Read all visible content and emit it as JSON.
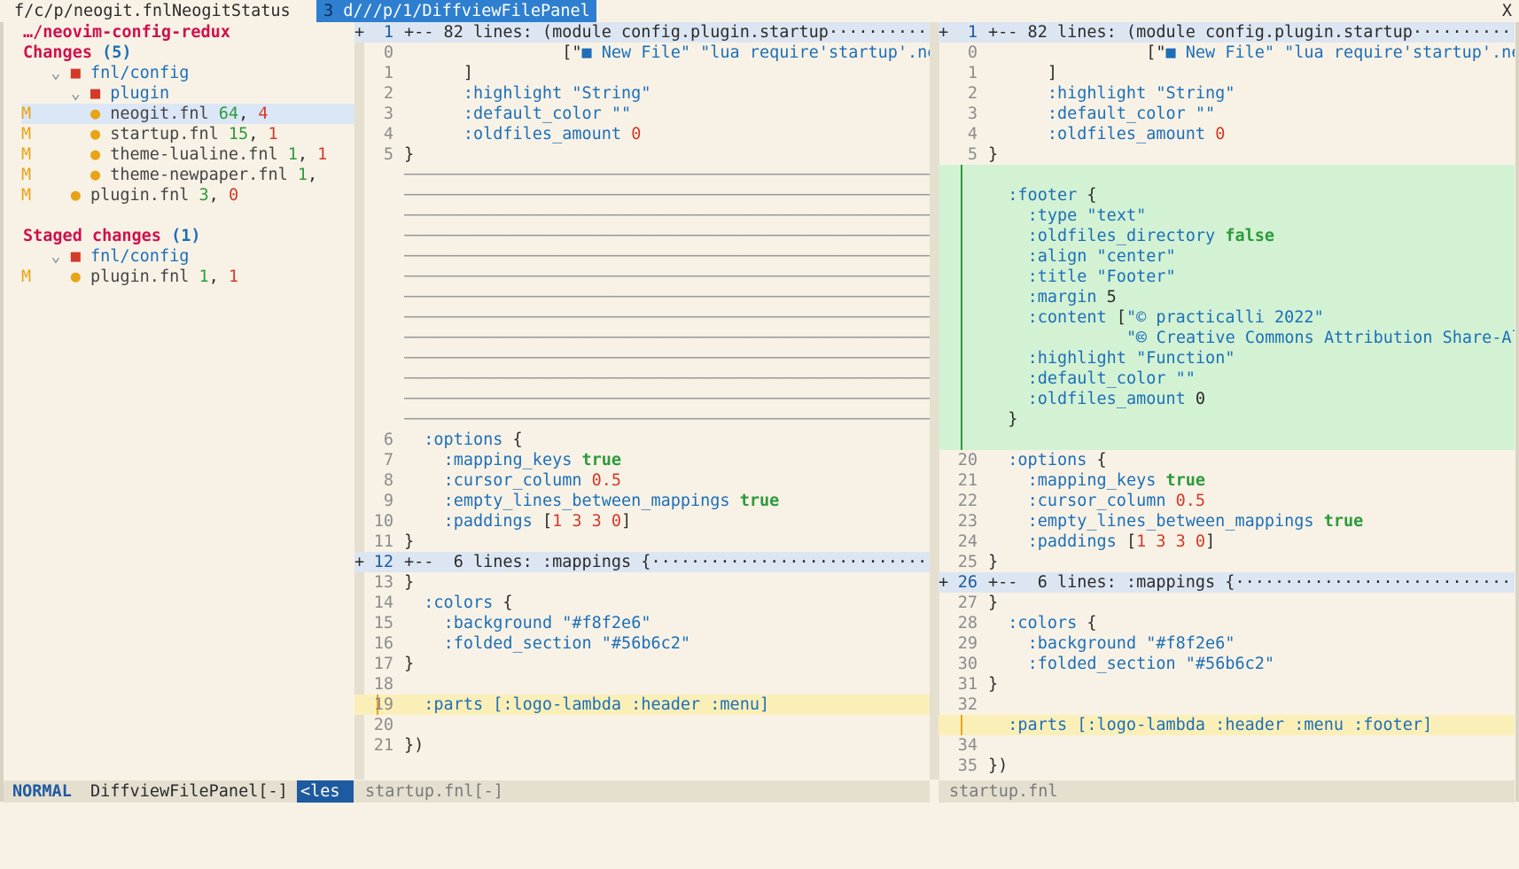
{
  "tabline": {
    "tab1": "f/c/p/neogit.fnl",
    "tab2": "NeogitStatus",
    "tab3_num": "3",
    "tab3_label": "d///p/1/DiffviewFilePanel",
    "close": "X"
  },
  "file_panel": {
    "root": "…/neovim-config-redux",
    "changes_header": "Changes",
    "changes_count": "(5)",
    "staged_header": "Staged changes",
    "staged_count": "(1)",
    "changes": [
      {
        "type": "dir",
        "depth": 1,
        "name": "fnl/config"
      },
      {
        "type": "dir",
        "depth": 2,
        "name": "plugin"
      },
      {
        "type": "file",
        "depth": 3,
        "status": "M",
        "name": "neogit.fnl",
        "add": "64",
        "del": "4",
        "selected": true
      },
      {
        "type": "file",
        "depth": 3,
        "status": "M",
        "name": "startup.fnl",
        "add": "15",
        "del": "1"
      },
      {
        "type": "file",
        "depth": 3,
        "status": "M",
        "name": "theme-lualine.fnl",
        "add": "1",
        "del": "1"
      },
      {
        "type": "file",
        "depth": 3,
        "status": "M",
        "name": "theme-newpaper.fnl",
        "add": "1",
        "del": ""
      },
      {
        "type": "file",
        "depth": 2,
        "status": "M",
        "name": "plugin.fnl",
        "add": "3",
        "del": "0"
      }
    ],
    "staged": [
      {
        "type": "dir",
        "depth": 1,
        "name": "fnl/config"
      },
      {
        "type": "file",
        "depth": 2,
        "status": "M",
        "name": "plugin.fnl",
        "add": "1",
        "del": "1"
      }
    ]
  },
  "left_pane": {
    "lines": [
      {
        "kind": "fold",
        "sign": "+",
        "ln": "1",
        "text": "+-- 82 lines: (module config.plugin.startup··········"
      },
      {
        "kind": "code",
        "ln": "0",
        "segs": [
          [
            "                [\"",
            ""
          ],
          [
            "■ ",
            "nf"
          ],
          [
            "New File\" \"lua require'startup'.new_fi",
            "str"
          ]
        ]
      },
      {
        "kind": "code",
        "ln": "1",
        "segs": [
          [
            "      ]",
            ""
          ]
        ]
      },
      {
        "kind": "code",
        "ln": "2",
        "segs": [
          [
            "      ",
            ""
          ],
          [
            ":highlight",
            "kw"
          ],
          [
            " ",
            ""
          ],
          [
            "\"String\"",
            "str"
          ]
        ]
      },
      {
        "kind": "code",
        "ln": "3",
        "segs": [
          [
            "      ",
            ""
          ],
          [
            ":default_color",
            "kw"
          ],
          [
            " ",
            ""
          ],
          [
            "\"\"",
            "str"
          ]
        ]
      },
      {
        "kind": "code",
        "ln": "4",
        "segs": [
          [
            "      ",
            ""
          ],
          [
            ":oldfiles_amount",
            "kw"
          ],
          [
            " ",
            ""
          ],
          [
            "0",
            "num"
          ]
        ]
      },
      {
        "kind": "code",
        "ln": "5",
        "segs": [
          [
            "}",
            ""
          ]
        ]
      },
      {
        "kind": "filler"
      },
      {
        "kind": "filler"
      },
      {
        "kind": "filler"
      },
      {
        "kind": "filler"
      },
      {
        "kind": "filler"
      },
      {
        "kind": "filler"
      },
      {
        "kind": "filler"
      },
      {
        "kind": "filler"
      },
      {
        "kind": "filler"
      },
      {
        "kind": "filler"
      },
      {
        "kind": "filler"
      },
      {
        "kind": "filler"
      },
      {
        "kind": "filler"
      },
      {
        "kind": "code",
        "ln": "6",
        "segs": [
          [
            "  ",
            ""
          ],
          [
            ":options",
            "kw"
          ],
          [
            " {",
            ""
          ]
        ]
      },
      {
        "kind": "code",
        "ln": "7",
        "segs": [
          [
            "    ",
            ""
          ],
          [
            ":mapping_keys",
            "kw"
          ],
          [
            " ",
            ""
          ],
          [
            "true",
            "bool"
          ]
        ]
      },
      {
        "kind": "code",
        "ln": "8",
        "segs": [
          [
            "    ",
            ""
          ],
          [
            ":cursor_column",
            "kw"
          ],
          [
            " ",
            ""
          ],
          [
            "0.5",
            "num"
          ]
        ]
      },
      {
        "kind": "code",
        "ln": "9",
        "segs": [
          [
            "    ",
            ""
          ],
          [
            ":empty_lines_between_mappings",
            "kw"
          ],
          [
            " ",
            ""
          ],
          [
            "true",
            "bool"
          ]
        ]
      },
      {
        "kind": "code",
        "ln": "10",
        "segs": [
          [
            "    ",
            ""
          ],
          [
            ":paddings",
            "kw"
          ],
          [
            " [",
            ""
          ],
          [
            "1 3 3 0",
            "num"
          ],
          [
            "]",
            ""
          ]
        ]
      },
      {
        "kind": "code",
        "ln": "11",
        "segs": [
          [
            "}",
            ""
          ]
        ]
      },
      {
        "kind": "fold",
        "sign": "+",
        "ln": "12",
        "text": "+--  6 lines: :mappings {·····························"
      },
      {
        "kind": "code",
        "ln": "13",
        "segs": [
          [
            "}",
            ""
          ]
        ]
      },
      {
        "kind": "code",
        "ln": "14",
        "segs": [
          [
            "  ",
            ""
          ],
          [
            ":colors",
            "kw"
          ],
          [
            " {",
            ""
          ]
        ]
      },
      {
        "kind": "code",
        "ln": "15",
        "segs": [
          [
            "    ",
            ""
          ],
          [
            ":background",
            "kw"
          ],
          [
            " ",
            ""
          ],
          [
            "\"#f8f2e6\"",
            "str"
          ]
        ]
      },
      {
        "kind": "code",
        "ln": "16",
        "segs": [
          [
            "    ",
            ""
          ],
          [
            ":folded_section",
            "kw"
          ],
          [
            " ",
            ""
          ],
          [
            "\"#56b6c2\"",
            "str"
          ]
        ]
      },
      {
        "kind": "code",
        "ln": "17",
        "segs": [
          [
            "}",
            ""
          ]
        ]
      },
      {
        "kind": "code",
        "ln": "18",
        "segs": [
          [
            "",
            ""
          ]
        ]
      },
      {
        "kind": "changed",
        "ln": "19",
        "segs": [
          [
            "  ",
            ""
          ],
          [
            ":parts [:logo-lambda :header :menu]",
            "kw"
          ]
        ]
      },
      {
        "kind": "code",
        "ln": "20",
        "segs": [
          [
            "",
            ""
          ]
        ]
      },
      {
        "kind": "code",
        "ln": "21",
        "segs": [
          [
            "})",
            ""
          ]
        ]
      }
    ],
    "status": "startup.fnl[-]"
  },
  "right_pane": {
    "lines": [
      {
        "kind": "fold",
        "sign": "+",
        "ln": "1",
        "text": "+-- 82 lines: (module config.plugin.startup··········"
      },
      {
        "kind": "code",
        "ln": "0",
        "segs": [
          [
            "                [\"",
            ""
          ],
          [
            "■ ",
            "nf"
          ],
          [
            "New File\" \"lua require'startup'.new_fi",
            "str"
          ]
        ]
      },
      {
        "kind": "code",
        "ln": "1",
        "segs": [
          [
            "      ]",
            ""
          ]
        ]
      },
      {
        "kind": "code",
        "ln": "2",
        "segs": [
          [
            "      ",
            ""
          ],
          [
            ":highlight",
            "kw"
          ],
          [
            " ",
            ""
          ],
          [
            "\"String\"",
            "str"
          ]
        ]
      },
      {
        "kind": "code",
        "ln": "3",
        "segs": [
          [
            "      ",
            ""
          ],
          [
            ":default_color",
            "kw"
          ],
          [
            " ",
            ""
          ],
          [
            "\"\"",
            "str"
          ]
        ]
      },
      {
        "kind": "code",
        "ln": "4",
        "segs": [
          [
            "      ",
            ""
          ],
          [
            ":oldfiles_amount",
            "kw"
          ],
          [
            " ",
            ""
          ],
          [
            "0",
            "num"
          ]
        ]
      },
      {
        "kind": "code",
        "ln": "5",
        "segs": [
          [
            "}",
            ""
          ]
        ]
      },
      {
        "kind": "added",
        "segs": [
          [
            "",
            ""
          ]
        ]
      },
      {
        "kind": "added",
        "segs": [
          [
            "  ",
            ""
          ],
          [
            ":footer",
            "kw"
          ],
          [
            " {",
            ""
          ]
        ]
      },
      {
        "kind": "added",
        "segs": [
          [
            "    ",
            ""
          ],
          [
            ":type",
            "kw"
          ],
          [
            " ",
            ""
          ],
          [
            "\"text\"",
            "str"
          ]
        ]
      },
      {
        "kind": "added",
        "segs": [
          [
            "    ",
            ""
          ],
          [
            ":oldfiles_directory",
            "kw"
          ],
          [
            " ",
            ""
          ],
          [
            "false",
            "bool"
          ]
        ]
      },
      {
        "kind": "added",
        "segs": [
          [
            "    ",
            ""
          ],
          [
            ":align",
            "kw"
          ],
          [
            " ",
            ""
          ],
          [
            "\"center\"",
            "str"
          ]
        ]
      },
      {
        "kind": "added",
        "segs": [
          [
            "    ",
            ""
          ],
          [
            ":title",
            "kw"
          ],
          [
            " ",
            ""
          ],
          [
            "\"Footer\"",
            "str"
          ]
        ]
      },
      {
        "kind": "added",
        "segs": [
          [
            "    ",
            ""
          ],
          [
            ":margin",
            "kw"
          ],
          [
            " 5",
            ""
          ]
        ]
      },
      {
        "kind": "added",
        "segs": [
          [
            "    ",
            ""
          ],
          [
            ":content",
            "kw"
          ],
          [
            " [",
            ""
          ],
          [
            "\"© practicalli 2022\"",
            "str"
          ]
        ]
      },
      {
        "kind": "added",
        "segs": [
          [
            "              ",
            ""
          ],
          [
            "\"🅭 Creative Commons Attribution Share-Al",
            "str"
          ]
        ]
      },
      {
        "kind": "added",
        "segs": [
          [
            "    ",
            ""
          ],
          [
            ":highlight",
            "kw"
          ],
          [
            " ",
            ""
          ],
          [
            "\"Function\"",
            "str"
          ]
        ]
      },
      {
        "kind": "added",
        "segs": [
          [
            "    ",
            ""
          ],
          [
            ":default_color",
            "kw"
          ],
          [
            " ",
            ""
          ],
          [
            "\"\"",
            "str"
          ]
        ]
      },
      {
        "kind": "added",
        "segs": [
          [
            "    ",
            ""
          ],
          [
            ":oldfiles_amount",
            "kw"
          ],
          [
            " 0",
            ""
          ]
        ]
      },
      {
        "kind": "added",
        "segs": [
          [
            "  }",
            ""
          ]
        ]
      },
      {
        "kind": "added",
        "segs": [
          [
            "",
            ""
          ]
        ]
      },
      {
        "kind": "code",
        "ln": "20",
        "segs": [
          [
            "  ",
            ""
          ],
          [
            ":options",
            "kw"
          ],
          [
            " {",
            ""
          ]
        ]
      },
      {
        "kind": "code",
        "ln": "21",
        "segs": [
          [
            "    ",
            ""
          ],
          [
            ":mapping_keys",
            "kw"
          ],
          [
            " ",
            ""
          ],
          [
            "true",
            "bool"
          ]
        ]
      },
      {
        "kind": "code",
        "ln": "22",
        "segs": [
          [
            "    ",
            ""
          ],
          [
            ":cursor_column",
            "kw"
          ],
          [
            " ",
            ""
          ],
          [
            "0.5",
            "num"
          ]
        ]
      },
      {
        "kind": "code",
        "ln": "23",
        "segs": [
          [
            "    ",
            ""
          ],
          [
            ":empty_lines_between_mappings",
            "kw"
          ],
          [
            " ",
            ""
          ],
          [
            "true",
            "bool"
          ]
        ]
      },
      {
        "kind": "code",
        "ln": "24",
        "segs": [
          [
            "    ",
            ""
          ],
          [
            ":paddings",
            "kw"
          ],
          [
            " [",
            ""
          ],
          [
            "1 3 3 0",
            "num"
          ],
          [
            "]",
            ""
          ]
        ]
      },
      {
        "kind": "code",
        "ln": "25",
        "segs": [
          [
            "}",
            ""
          ]
        ]
      },
      {
        "kind": "fold",
        "sign": "+",
        "ln": "26",
        "text": "+--  6 lines: :mappings {·····························"
      },
      {
        "kind": "code",
        "ln": "27",
        "segs": [
          [
            "}",
            ""
          ]
        ]
      },
      {
        "kind": "code",
        "ln": "28",
        "segs": [
          [
            "  ",
            ""
          ],
          [
            ":colors",
            "kw"
          ],
          [
            " {",
            ""
          ]
        ]
      },
      {
        "kind": "code",
        "ln": "29",
        "segs": [
          [
            "    ",
            ""
          ],
          [
            ":background",
            "kw"
          ],
          [
            " ",
            ""
          ],
          [
            "\"#f8f2e6\"",
            "str"
          ]
        ]
      },
      {
        "kind": "code",
        "ln": "30",
        "segs": [
          [
            "    ",
            ""
          ],
          [
            ":folded_section",
            "kw"
          ],
          [
            " ",
            ""
          ],
          [
            "\"#56b6c2\"",
            "str"
          ]
        ]
      },
      {
        "kind": "code",
        "ln": "31",
        "segs": [
          [
            "}",
            ""
          ]
        ]
      },
      {
        "kind": "code",
        "ln": "32",
        "segs": [
          [
            "",
            ""
          ]
        ]
      },
      {
        "kind": "changed",
        "ln": "",
        "segs": [
          [
            "  ",
            ""
          ],
          [
            ":parts [:logo-lambda :header :menu :footer]",
            "kw"
          ]
        ]
      },
      {
        "kind": "code",
        "ln": "34",
        "segs": [
          [
            "",
            ""
          ]
        ]
      },
      {
        "kind": "code",
        "ln": "35",
        "segs": [
          [
            "})",
            ""
          ]
        ]
      }
    ],
    "status": "startup.fnl"
  },
  "statusline": {
    "mode": "NORMAL",
    "panel": "DiffviewFilePanel[-]",
    "tail": "<les"
  },
  "colors": {
    "background": "#f8f2e6",
    "accent": "#2f7fd1",
    "added_bg": "#d3f2d3",
    "changed_bg": "#fbefb8",
    "fold_bg": "#dce6f2",
    "keyword": "#1c6fb8",
    "error_red": "#d23a2a",
    "add_green": "#2c9a3b"
  }
}
